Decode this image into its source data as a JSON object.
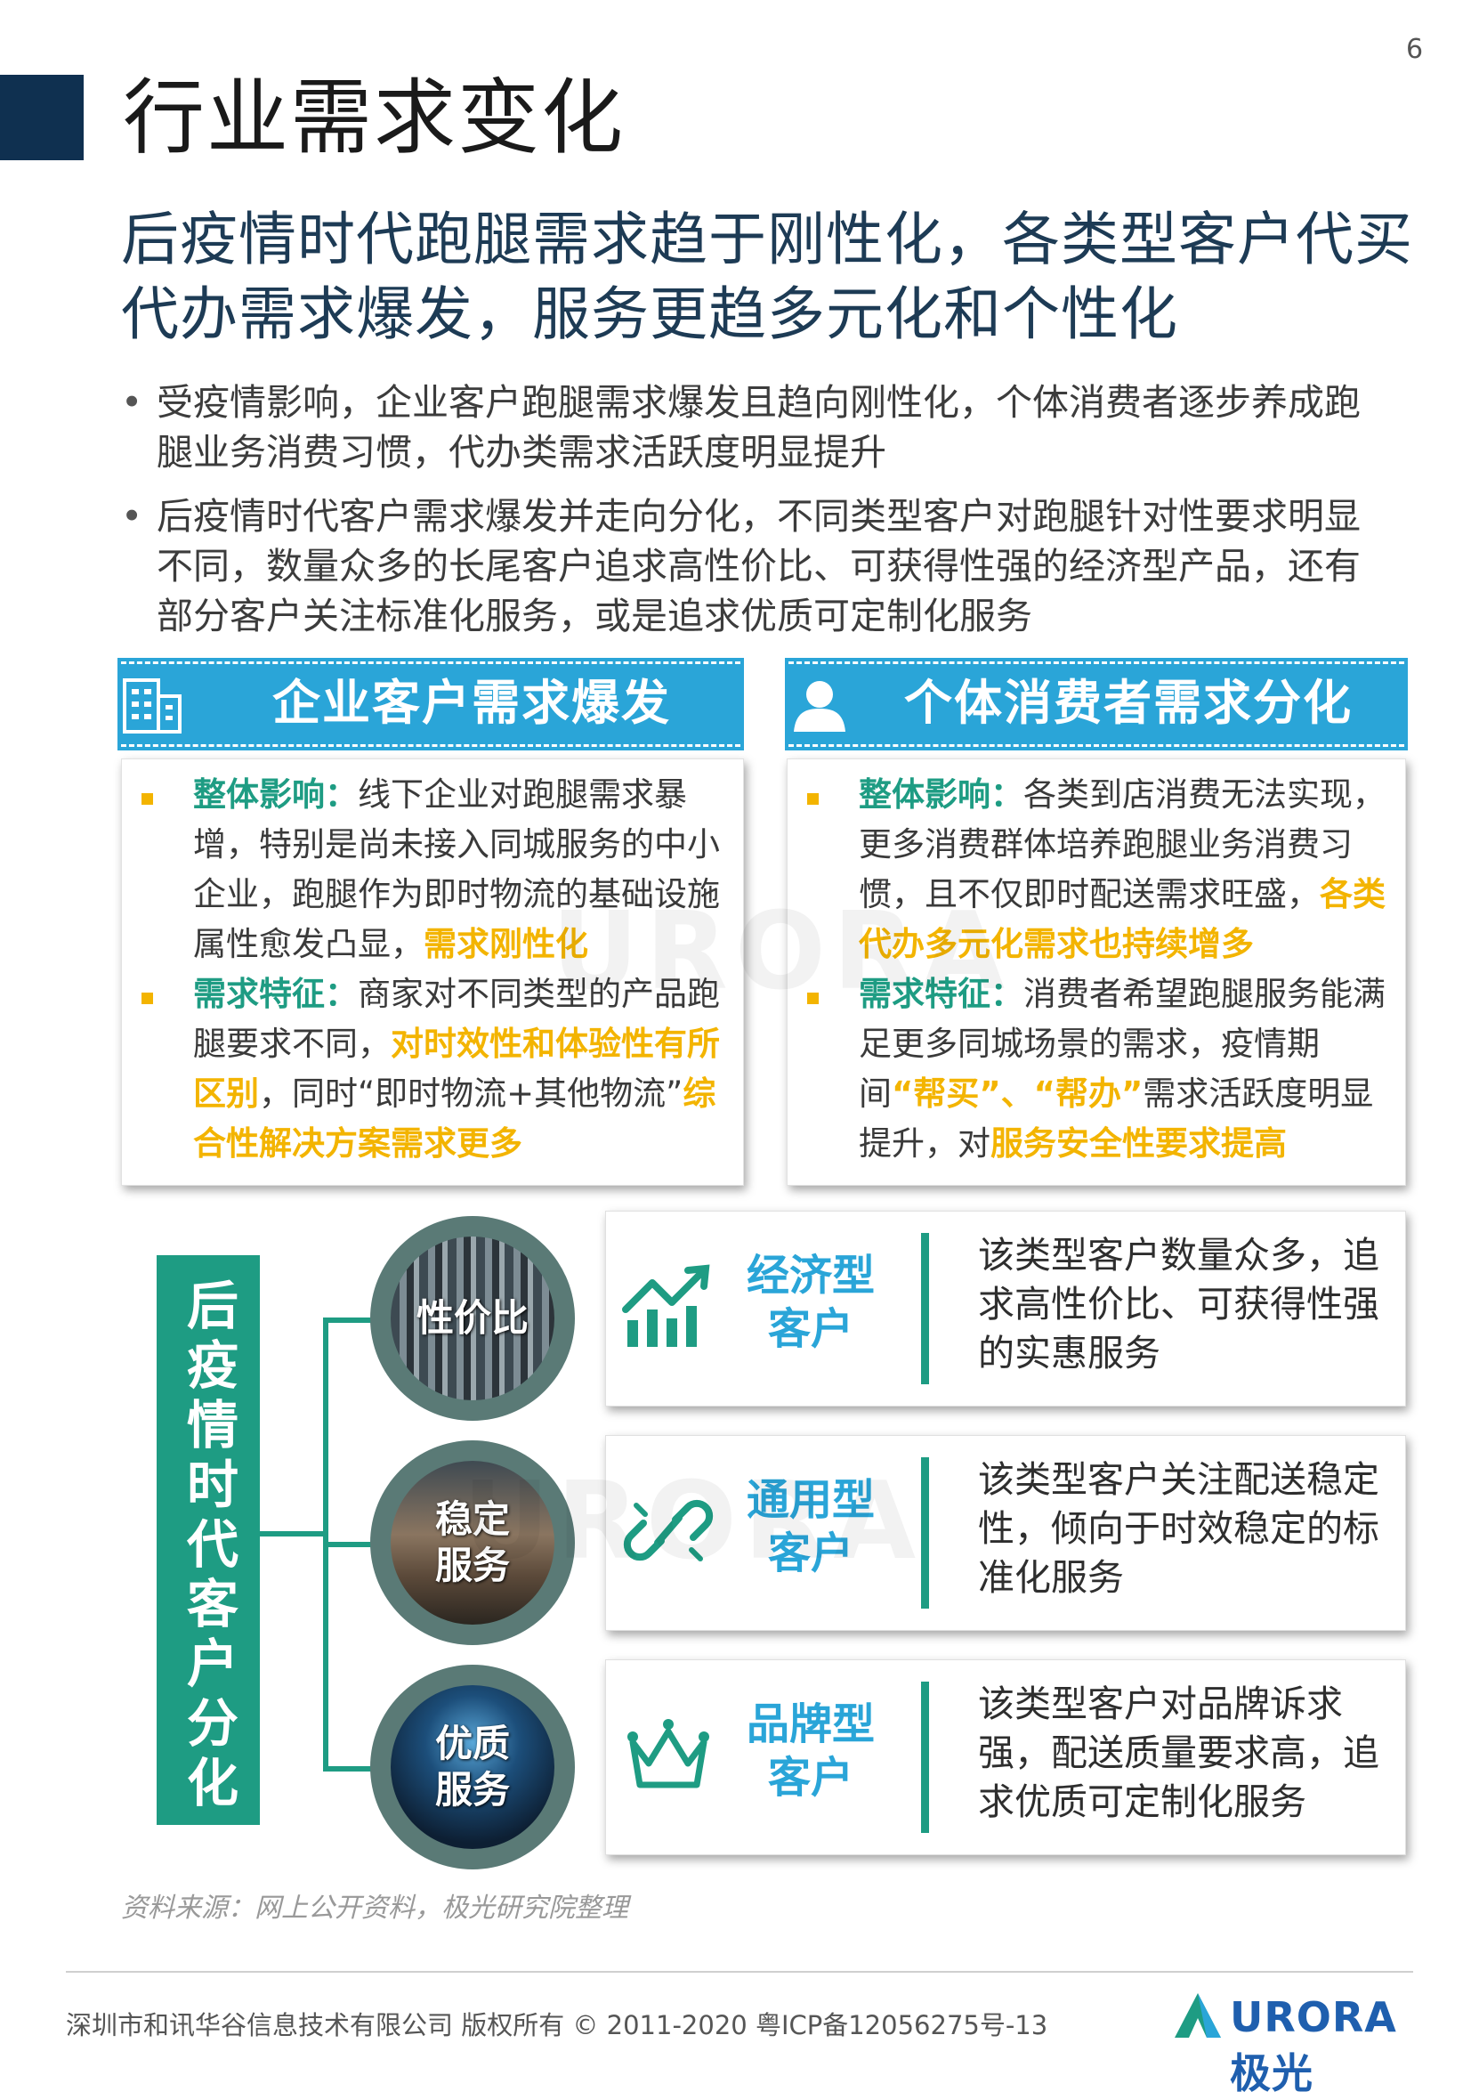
{
  "page": {
    "number": "6",
    "title": "行业需求变化",
    "headline": "后疫情时代跑腿需求趋于刚性化，各类型客户代买代办需求爆发，服务更趋多元化和个性化"
  },
  "bullets": [
    "受疫情影响，企业客户跑腿需求爆发且趋向刚性化，个体消费者逐步养成跑腿业务消费习惯，代办类需求活跃度明显提升",
    "后疫情时代客户需求爆发并走向分化，不同类型客户对跑腿针对性要求明显不同，数量众多的长尾客户追求高性价比、可获得性强的经济型产品，还有部分客户关注标准化服务，或是追求优质可定制化服务"
  ],
  "enterprise": {
    "title": "企业客户需求爆发",
    "icon": "building-icon",
    "item1": {
      "label": "整体影响：",
      "text": "线下企业对跑腿需求暴增，特别是尚未接入同城服务的中小企业，跑腿作为即时物流的基础设施属性愈发凸显，",
      "highlight": "需求刚性化"
    },
    "item2": {
      "label": "需求特征：",
      "text1": "商家对不同类型的产品跑腿要求不同，",
      "highlight1": "对时效性和体验性有所区别",
      "text2": "，同时“即时物流+其他物流”",
      "highlight2": "综合性解决方案需求更多"
    }
  },
  "individual": {
    "title": "个体消费者需求分化",
    "icon": "person-icon",
    "item1": {
      "label": "整体影响：",
      "text": "各类到店消费无法实现，更多消费群体培养跑腿业务消费习惯，且不仅即时配送需求旺盛，",
      "highlight": "各类代办多元化需求也持续增多"
    },
    "item2": {
      "label": "需求特征：",
      "text1": "消费者希望跑腿服务能满足更多同城场景的需求，疫情期间",
      "highlight1": "“帮买”、“帮办”",
      "text2": "需求活跃度明显提升，对",
      "highlight2": "服务安全性要求提高"
    }
  },
  "segment_label": "后疫情时代客户分化",
  "segments": [
    {
      "circle": "性价比",
      "name_line1": "经济型",
      "name_line2": "客户",
      "icon": "bar-chart-trend-icon",
      "desc": "该类型客户数量众多，追求高性价比、可获得性强的实惠服务"
    },
    {
      "circle_line1": "稳定",
      "circle_line2": "服务",
      "name_line1": "通用型",
      "name_line2": "客户",
      "icon": "link-broken-icon",
      "desc": "该类型客户关注配送稳定性，倾向于时效稳定的标准化服务"
    },
    {
      "circle_line1": "优质",
      "circle_line2": "服务",
      "name_line1": "品牌型",
      "name_line2": "客户",
      "icon": "crown-icon",
      "desc": "该类型客户对品牌诉求强，配送质量要求高，追求优质可定制化服务"
    }
  ],
  "source": "资料来源：网上公开资料，极光研究院整理",
  "footer": {
    "copyright": "深圳市和讯华谷信息技术有限公司 版权所有 © 2011-2020 粤ICP备12056275号-13",
    "brand": "URORA极光"
  },
  "watermark": "URORA",
  "colors": {
    "navy": "#0f3050",
    "blue": "#2aa5d8",
    "teal": "#1e9c83",
    "yellow": "#f3b400"
  }
}
